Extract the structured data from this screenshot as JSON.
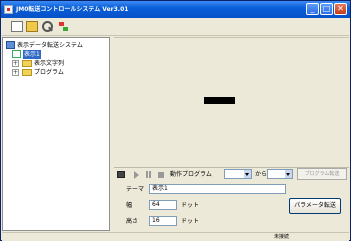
{
  "window": {
    "title": "JM0転送コントロールシステム Ver3.01"
  },
  "titlebar_buttons": {
    "minimize": "_",
    "maximize": "□",
    "close": "✕"
  },
  "toolbar": {
    "icons": [
      "new-document-icon",
      "open-folder-icon",
      "search-icon",
      "tree-view-icon"
    ]
  },
  "tree": {
    "root": "表示データ転送システム",
    "device": "表示1",
    "children": [
      "表示文字列",
      "プログラム"
    ]
  },
  "controls": {
    "program_label": "動作プログラム",
    "from_label": "から",
    "program_value": "",
    "from_value": "",
    "transfer_button": "プログラム転送"
  },
  "properties": {
    "theme_label": "テーマ",
    "theme_value": "表示1",
    "width_label": "幅",
    "width_value": "64",
    "width_unit": "ドット",
    "height_label": "高さ",
    "height_value": "16",
    "height_unit": "ドット",
    "param_button": "パラメータ転送"
  },
  "status": {
    "text": "未接続"
  }
}
